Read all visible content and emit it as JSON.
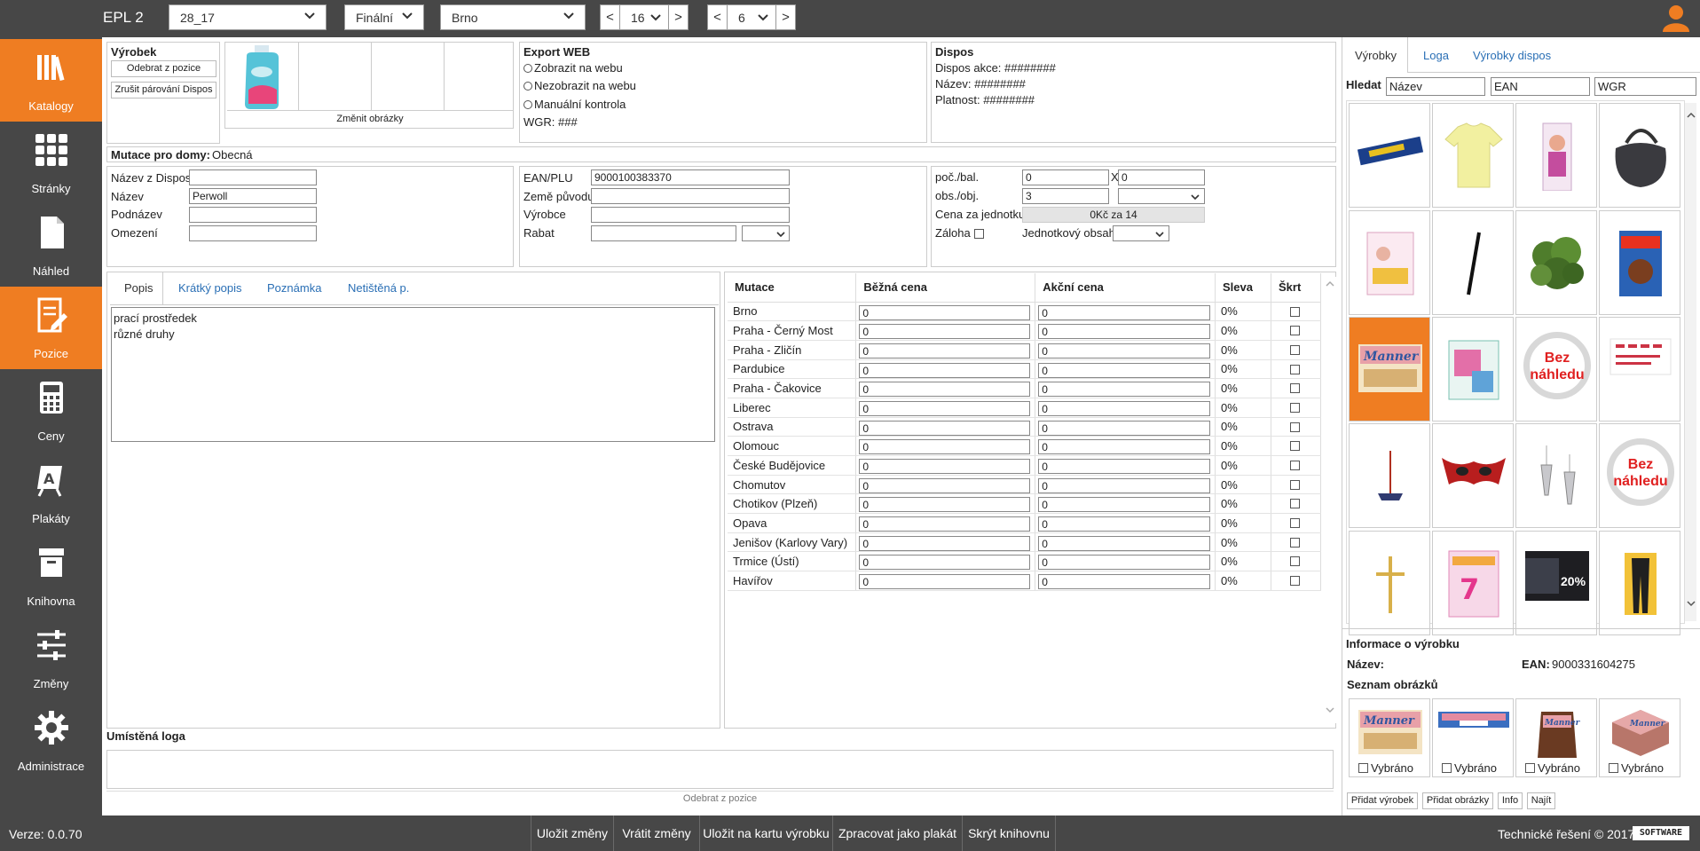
{
  "app": {
    "title": "EPL 2"
  },
  "topbar": {
    "catalog_select": "28_17",
    "state_select": "Finální",
    "city_select": "Brno",
    "page_value": "16",
    "pos_value": "6",
    "prev_glyph": "<",
    "next_glyph": ">",
    "chevron": "⌄"
  },
  "sidebar": {
    "items": [
      {
        "label": "Katalogy",
        "icon": "books-icon",
        "active": true
      },
      {
        "label": "Stránky",
        "icon": "grid-icon",
        "active": false
      },
      {
        "label": "Náhled",
        "icon": "document-icon",
        "active": false
      },
      {
        "label": "Pozice",
        "icon": "edit-document-icon",
        "active": true
      },
      {
        "label": "Ceny",
        "icon": "calculator-icon",
        "active": false
      },
      {
        "label": "Plakáty",
        "icon": "poster-icon",
        "active": false
      },
      {
        "label": "Knihovna",
        "icon": "archive-icon",
        "active": false
      },
      {
        "label": "Změny",
        "icon": "sliders-icon",
        "active": false
      },
      {
        "label": "Administrace",
        "icon": "gear-icon",
        "active": false
      }
    ]
  },
  "product": {
    "title": "Výrobek",
    "remove_btn": "Odebrat z pozice",
    "cancel_pair_btn": "Zrušit párování Dispos",
    "change_images": "Změnit obrázky"
  },
  "export_web": {
    "title": "Export WEB",
    "opt1": "Zobrazit na webu",
    "opt2": "Nezobrazit na webu",
    "opt3": "Manuální kontrola",
    "wgr": "WGR: ###"
  },
  "dispos": {
    "title": "Dispos",
    "akce": "Dispos akce: ########",
    "nazev": "Název: ########",
    "platnost": "Platnost: ########"
  },
  "mutation": {
    "label": "Mutace pro domy:",
    "value": "Obecná"
  },
  "names": {
    "dispos_name_label": "Název z Dispos",
    "name_label": "Název",
    "name_value": "Perwoll",
    "subname_label": "Podnázev",
    "limit_label": "Omezení"
  },
  "ean_panel": {
    "ean_label": "EAN/PLU",
    "ean_value": "9000100383370",
    "origin_label": "Země původu",
    "maker_label": "Výrobce",
    "discount_label": "Rabat"
  },
  "pack": {
    "pcs_label": "poč./bal.",
    "pcs_value": "0",
    "x": "X",
    "pcs_value2": "0",
    "vol_label": "obs./obj.",
    "vol_value": "3",
    "unit_price_label": "Cena za jednotku",
    "unit_price_value": "0Kč za 14",
    "deposit_label": "Záloha",
    "unit_content_label": "Jednotkový obsah"
  },
  "desc_tabs": {
    "tabs": [
      "Popis",
      "Krátký popis",
      "Poznámka",
      "Netištěná p."
    ],
    "line1": "prací prostředek",
    "line2": "různé druhy"
  },
  "prices": {
    "headers": [
      "Mutace",
      "Běžná cena",
      "Akční cena",
      "Sleva",
      "Škrt"
    ],
    "rows": [
      {
        "name": "Brno",
        "regular": "0",
        "action": "0",
        "discount": "0%"
      },
      {
        "name": "Praha - Černý Most",
        "regular": "0",
        "action": "0",
        "discount": "0%"
      },
      {
        "name": "Praha - Zličín",
        "regular": "0",
        "action": "0",
        "discount": "0%"
      },
      {
        "name": "Pardubice",
        "regular": "0",
        "action": "0",
        "discount": "0%"
      },
      {
        "name": "Praha - Čakovice",
        "regular": "0",
        "action": "0",
        "discount": "0%"
      },
      {
        "name": "Liberec",
        "regular": "0",
        "action": "0",
        "discount": "0%"
      },
      {
        "name": "Ostrava",
        "regular": "0",
        "action": "0",
        "discount": "0%"
      },
      {
        "name": "Olomouc",
        "regular": "0",
        "action": "0",
        "discount": "0%"
      },
      {
        "name": "České Budějovice",
        "regular": "0",
        "action": "0",
        "discount": "0%"
      },
      {
        "name": "Chomutov",
        "regular": "0",
        "action": "0",
        "discount": "0%"
      },
      {
        "name": "Chotikov (Plzeň)",
        "regular": "0",
        "action": "0",
        "discount": "0%"
      },
      {
        "name": "Opava",
        "regular": "0",
        "action": "0",
        "discount": "0%"
      },
      {
        "name": "Jenišov (Karlovy Vary)",
        "regular": "0",
        "action": "0",
        "discount": "0%"
      },
      {
        "name": "Trmice (Ústí)",
        "regular": "0",
        "action": "0",
        "discount": "0%"
      },
      {
        "name": "Havířov",
        "regular": "0",
        "action": "0",
        "discount": "0%"
      }
    ]
  },
  "logos": {
    "title": "Umístěná loga",
    "remove": "Odebrat z pozice"
  },
  "right": {
    "tabs": [
      "Výrobky",
      "Loga",
      "Výrobky dispos"
    ],
    "search_label": "Hledat",
    "search_name_placeholder": "Název",
    "search_ean_placeholder": "EAN",
    "search_wgr_placeholder": "WGR",
    "no_preview": "Bez náhledu",
    "info_title": "Informace o výrobku",
    "info_name_label": "Název:",
    "info_ean_label": "EAN:",
    "info_ean_value": "9000331604275",
    "images_title": "Seznam obrázků",
    "selected_label": "Vybráno",
    "btn_add_product": "Přidat výrobek",
    "btn_add_images": "Přidat obrázky",
    "btn_info": "Info",
    "btn_find": "Najít",
    "badge_20": "20%"
  },
  "status": {
    "version": "Verze: 0.0.70",
    "save": "Uložit změny",
    "revert": "Vrátit změny",
    "save_card": "Uložit na kartu výrobku",
    "poster": "Zpracovat jako plakát",
    "hide_lib": "Skrýt knihovnu",
    "copyright": "Technické řešení © 2017",
    "software_logo": "SOFTWARE"
  },
  "colors": {
    "accent": "#ef7d22",
    "dark": "#474747",
    "link": "#2a6fb5"
  }
}
